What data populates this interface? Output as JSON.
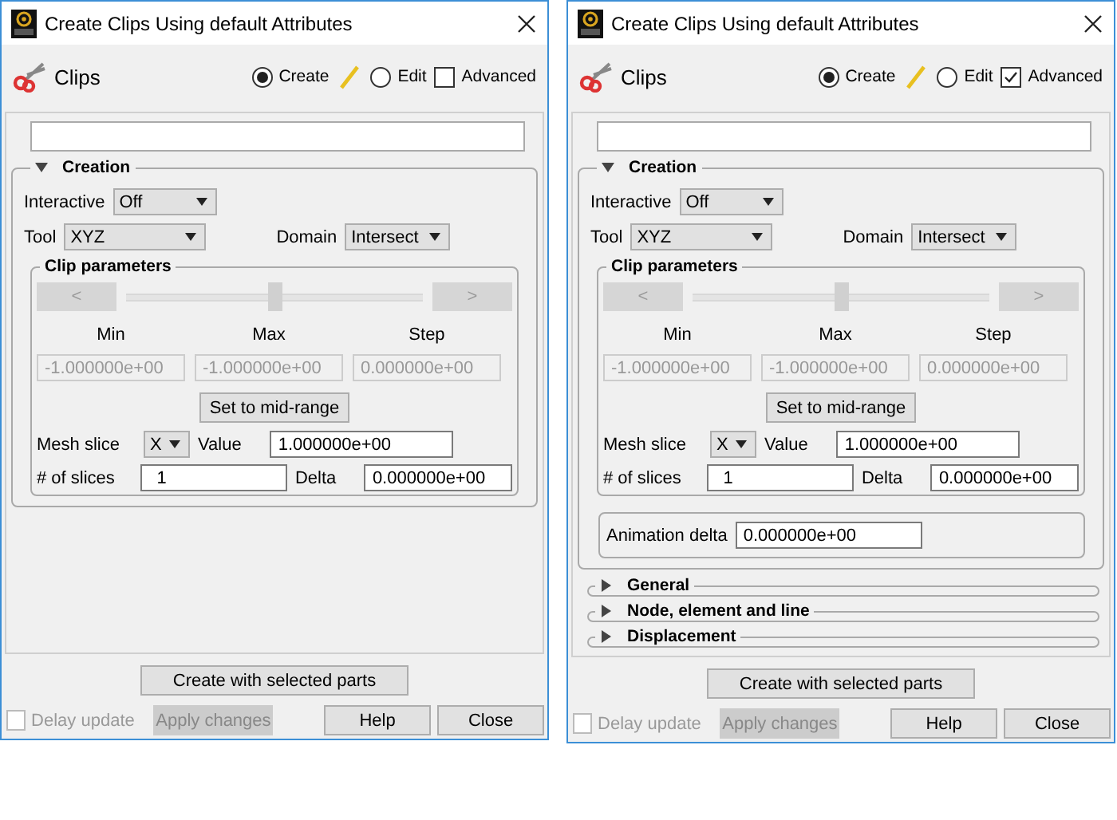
{
  "windows": [
    {
      "title": "Create Clips Using default Attributes",
      "tool_label": "Clips",
      "modes": [
        {
          "label": "Create",
          "selected": true
        },
        {
          "label": "Edit",
          "selected": false
        }
      ],
      "advanced": {
        "label": "Advanced",
        "checked": false
      },
      "sections": [
        {
          "kind": "creation",
          "title": "Creation",
          "expanded": true,
          "interactive": {
            "label": "Interactive",
            "value": "Off"
          },
          "tool": {
            "label": "Tool",
            "value": "XYZ"
          },
          "domain": {
            "label": "Domain",
            "value": "Intersect"
          },
          "clip_parameters": {
            "title": "Clip parameters",
            "prev": "<",
            "next": ">",
            "level": 0.5,
            "columns": [
              {
                "label": "Min",
                "value": "-1.000000e+00",
                "disabled": true
              },
              {
                "label": "Max",
                "value": "-1.000000e+00",
                "disabled": true
              },
              {
                "label": "Step",
                "value": "0.000000e+00",
                "disabled": true
              }
            ],
            "mid_range_button": "Set to mid-range",
            "mesh_slice": {
              "label": "Mesh slice",
              "value": "X"
            },
            "value_field": {
              "label": "Value",
              "value": "1.000000e+00"
            },
            "slices": {
              "label": "# of slices",
              "value": "1"
            },
            "delta": {
              "label": "Delta",
              "value": "0.000000e+00"
            }
          }
        }
      ],
      "create_button": "Create with selected parts",
      "delay_update": {
        "label": "Delay update",
        "checked": false,
        "disabled": true
      },
      "buttons": [
        {
          "label": "Apply changes",
          "disabled": true
        },
        {
          "label": "Help",
          "disabled": false
        },
        {
          "label": "Close",
          "disabled": false
        }
      ]
    },
    {
      "title": "Create Clips Using default Attributes",
      "tool_label": "Clips",
      "modes": [
        {
          "label": "Create",
          "selected": true
        },
        {
          "label": "Edit",
          "selected": false
        }
      ],
      "advanced": {
        "label": "Advanced",
        "checked": true
      },
      "sections": [
        {
          "kind": "creation",
          "title": "Creation",
          "expanded": true,
          "interactive": {
            "label": "Interactive",
            "value": "Off"
          },
          "tool": {
            "label": "Tool",
            "value": "XYZ"
          },
          "domain": {
            "label": "Domain",
            "value": "Intersect"
          },
          "clip_parameters": {
            "title": "Clip parameters",
            "prev": "<",
            "next": ">",
            "level": 0.5,
            "columns": [
              {
                "label": "Min",
                "value": "-1.000000e+00",
                "disabled": true
              },
              {
                "label": "Max",
                "value": "-1.000000e+00",
                "disabled": true
              },
              {
                "label": "Step",
                "value": "0.000000e+00",
                "disabled": true
              }
            ],
            "mid_range_button": "Set to mid-range",
            "mesh_slice": {
              "label": "Mesh slice",
              "value": "X"
            },
            "value_field": {
              "label": "Value",
              "value": "1.000000e+00"
            },
            "slices": {
              "label": "# of slices",
              "value": "1"
            },
            "delta": {
              "label": "Delta",
              "value": "0.000000e+00"
            }
          },
          "animation_delta": {
            "label": "Animation delta",
            "value": "0.000000e+00"
          }
        },
        {
          "kind": "group",
          "title": "General",
          "expanded": false
        },
        {
          "kind": "group",
          "title": "Node, element and line",
          "expanded": false
        },
        {
          "kind": "group",
          "title": "Displacement",
          "expanded": false
        }
      ],
      "create_button": "Create with selected parts",
      "delay_update": {
        "label": "Delay update",
        "checked": false,
        "disabled": true
      },
      "buttons": [
        {
          "label": "Apply changes",
          "disabled": true
        },
        {
          "label": "Help",
          "disabled": false
        },
        {
          "label": "Close",
          "disabled": false
        }
      ]
    }
  ]
}
